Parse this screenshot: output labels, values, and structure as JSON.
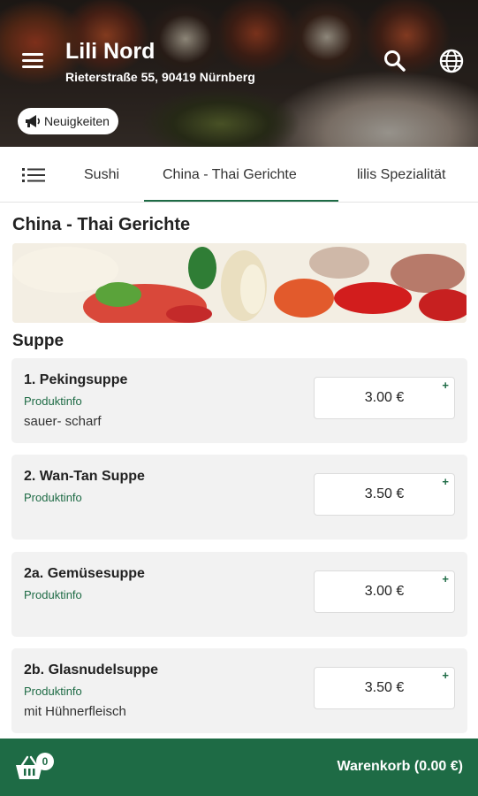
{
  "header": {
    "title": "Lili Nord",
    "address": "Rieterstraße 55, 90419 Nürnberg",
    "news_label": "Neuigkeiten"
  },
  "icons": {
    "menu": "hamburger-menu-icon",
    "search": "search-icon",
    "language": "globe-icon",
    "news": "megaphone-icon",
    "tab_list": "list-icon",
    "cart": "basket-icon"
  },
  "tabs": [
    {
      "label": "Sushi",
      "active": false
    },
    {
      "label": "China - Thai Gerichte",
      "active": true
    },
    {
      "label": "lilis Spezialität",
      "active": false
    }
  ],
  "section": {
    "title": "China - Thai Gerichte",
    "subsection": "Suppe"
  },
  "products": [
    {
      "name": "1. Pekingsuppe",
      "info": "Produktinfo",
      "description": "sauer- scharf",
      "price": "3.00 €"
    },
    {
      "name": "2. Wan-Tan Suppe",
      "info": "Produktinfo",
      "description": "",
      "price": "3.50 €"
    },
    {
      "name": "2a. Gemüsesuppe",
      "info": "Produktinfo",
      "description": "",
      "price": "3.00 €"
    },
    {
      "name": "2b. Glasnudelsuppe",
      "info": "Produktinfo",
      "description": "mit Hühnerfleisch",
      "price": "3.50 €"
    }
  ],
  "add_symbol": "+",
  "cart": {
    "count": "0",
    "label": "Warenkorb (0.00 €)"
  },
  "colors": {
    "accent": "#1e6b45",
    "card_background": "#f2f2f2"
  }
}
